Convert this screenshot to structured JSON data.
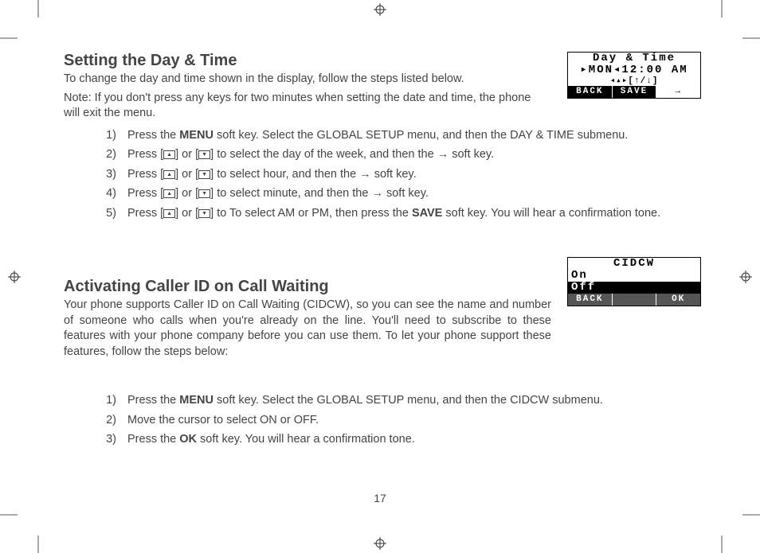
{
  "page_number": "17",
  "section1": {
    "heading": "Setting the Day & Time",
    "intro1": "To change the day and time shown in the display, follow the steps listed below.",
    "intro2": "Note: If you don't press any keys for two minutes when setting the date and time, the phone will exit the menu.",
    "steps": {
      "s1a": "Press the ",
      "s1b": "MENU",
      "s1c": " soft key. Select the GLOBAL SETUP menu, and then the DAY & TIME submenu.",
      "s2": "] to select  the day of the week, and then the → soft key.",
      "s3": "] to select  hour, and then the → soft key.",
      "s4": "] to select  minute, and then the → soft key.",
      "s5a": "] to To select AM or PM, then press the ",
      "s5b": "SAVE",
      "s5c": " soft key. You will hear a confirmation tone.",
      "press_open": "Press [",
      "or_open": "] or ["
    },
    "lcd": {
      "line1": "Day & Time",
      "line2": "▸MON◂12:00 AM",
      "line3": "◂▴▸[↑/↓]",
      "btn_back": "BACK",
      "btn_save": "SAVE",
      "btn_arrow": "→"
    }
  },
  "section2": {
    "heading": "Activating Caller ID on Call Waiting",
    "intro": "Your phone supports Caller ID on Call Waiting (CIDCW), so you can see the name and number of someone who calls when you're already on the line. You'll need to subscribe to these features with your phone company before you can use them. To let your phone support these features, follow the steps below:",
    "steps": {
      "s1a": "Press the ",
      "s1b": "MENU",
      "s1c": " soft key. Select the GLOBAL SETUP menu, and then the CIDCW submenu.",
      "s2": "Move the cursor to select ON or OFF.",
      "s3a": "Press the ",
      "s3b": "OK",
      "s3c": " soft key. You will hear a confirmation tone."
    },
    "lcd": {
      "title": "CIDCW",
      "opt_on": "On",
      "opt_off": "Off",
      "btn_back": "BACK",
      "btn_ok": "OK"
    }
  }
}
